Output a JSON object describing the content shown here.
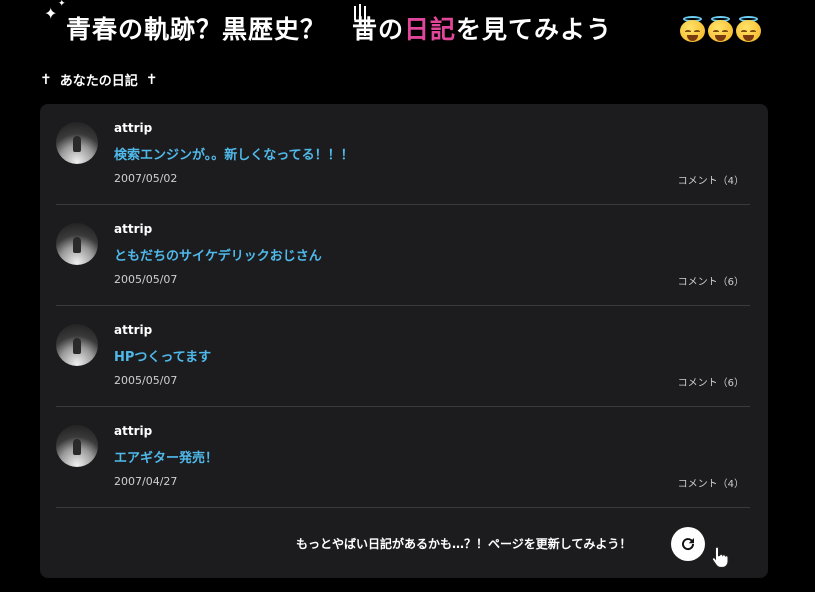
{
  "headline": {
    "part1": "青春の軌跡？黒歴史？",
    "part2": "昔の",
    "highlight": "日記",
    "part3": "を見てみよう",
    "highlight_color": "#e0469a"
  },
  "section": {
    "title": "あなたの日記"
  },
  "entries": [
    {
      "user": "attrip",
      "title": "検索エンジンが。。新しくなってる！！！",
      "date": "2007/05/02",
      "comments": "コメント（4）"
    },
    {
      "user": "attrip",
      "title": "ともだちのサイケデリックおじさん",
      "date": "2005/05/07",
      "comments": "コメント（6）"
    },
    {
      "user": "attrip",
      "title": "HPつくってます",
      "date": "2005/05/07",
      "comments": "コメント（6）"
    },
    {
      "user": "attrip",
      "title": "エアギター発売！",
      "date": "2007/04/27",
      "comments": "コメント（4）"
    }
  ],
  "refresh": {
    "text": "もっとやばい日記があるかも…？！ページを更新してみよう！"
  },
  "colors": {
    "link": "#4fb9ea",
    "panel": "#1c1c1e",
    "background": "#000000"
  }
}
